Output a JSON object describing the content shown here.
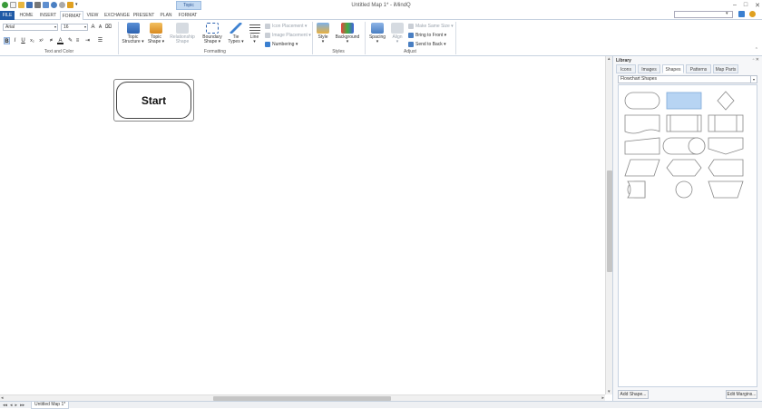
{
  "window": {
    "title": "Untitled Map 1* - iMindQ",
    "contextual_tab": "Topic",
    "controls": [
      "–",
      "□",
      "✕"
    ]
  },
  "tabs": [
    {
      "label": "FILE"
    },
    {
      "label": "HOME"
    },
    {
      "label": "INSERT"
    },
    {
      "label": "FORMAT"
    },
    {
      "label": "VIEW"
    },
    {
      "label": "EXCHANGE"
    },
    {
      "label": "PRESENT"
    },
    {
      "label": "PLAN"
    },
    {
      "label": "FORMAT"
    }
  ],
  "ribbon": {
    "text_and_color": {
      "font_name": "Arial",
      "font_size": "16",
      "buttons": [
        "B",
        "I",
        "U",
        "x₂",
        "x²",
        "A"
      ],
      "label": "Text and Color"
    },
    "formatting": {
      "topic_structure": [
        "Topic",
        "Structure ▾"
      ],
      "topic_shape": [
        "Topic",
        "Shape ▾"
      ],
      "relationship_shape": [
        "Relationship",
        "Shape"
      ],
      "boundary_shape": [
        "Boundary",
        "Shape ▾"
      ],
      "tie_types": [
        "Tie",
        "Types ▾"
      ],
      "line": [
        "Line",
        "▾"
      ],
      "icon_placement": "Icon Placement ▾",
      "image_placement": "Image Placement ▾",
      "numbering": "Numbering ▾",
      "label": "Formatting"
    },
    "styles": {
      "style": [
        "Style",
        "▾"
      ],
      "background": [
        "Background",
        "▾"
      ],
      "label": "Styles"
    },
    "adjust": {
      "spacing": [
        "Spacing",
        "▾"
      ],
      "align": [
        "Align",
        "▾"
      ],
      "make_same_size": "Make Same Size ▾",
      "bring_to_front": "Bring to Front ▾",
      "send_to_back": "Send to Back ▾",
      "label": "Adjust"
    }
  },
  "canvas": {
    "topic_text": "Start"
  },
  "library": {
    "title": "Library",
    "controls": "▫ ✕",
    "tabs": [
      {
        "label": "Icons"
      },
      {
        "label": "Images"
      },
      {
        "label": "Shapes"
      },
      {
        "label": "Patterns"
      },
      {
        "label": "Map Parts"
      }
    ],
    "selected_category": "Flowchart Shapes",
    "add_shape": "Add Shape...",
    "edit_margins": "Edit Margins..."
  },
  "status": {
    "nav_arrows": [
      "◂◂",
      "◂",
      "▸",
      "▸▸"
    ],
    "sheet_tab": "Untitled Map 1*"
  }
}
